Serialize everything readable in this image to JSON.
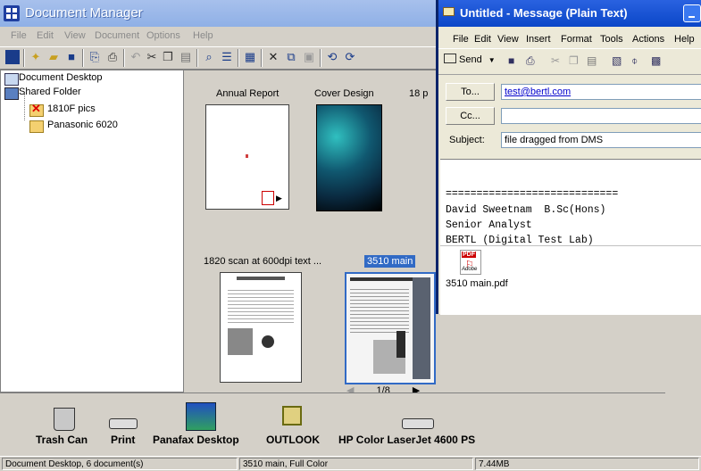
{
  "main_window": {
    "title": "Document Manager",
    "menu": [
      "File",
      "Edit",
      "View",
      "Document",
      "Options",
      "Help"
    ]
  },
  "tree": {
    "items": [
      {
        "label": "Document Desktop",
        "icon": "document-desktop-icon"
      },
      {
        "label": "Shared Folder",
        "icon": "shared-folder-icon"
      },
      {
        "label": "1810F pics",
        "icon": "folder-x-icon"
      },
      {
        "label": "Panasonic 6020",
        "icon": "folder-icon"
      }
    ]
  },
  "documents": [
    {
      "label": "Annual Report"
    },
    {
      "label": "Cover Design"
    },
    {
      "label": "18 p"
    },
    {
      "label": "1820 scan at 600dpi text ..."
    },
    {
      "label": "3510 main",
      "selected": true
    }
  ],
  "pager": {
    "text": "1/8"
  },
  "dock": {
    "items": [
      "Trash Can",
      "Print",
      "Panafax Desktop",
      "OUTLOOK",
      "HP Color LaserJet 4600 PS"
    ]
  },
  "status": {
    "left": "Document Desktop, 6 document(s)",
    "middle": "3510 main, Full Color",
    "right": "7.44MB"
  },
  "message": {
    "title": "Untitled - Message (Plain Text)",
    "menu": [
      "File",
      "Edit",
      "View",
      "Insert",
      "Format",
      "Tools",
      "Actions",
      "Help"
    ],
    "send_label": "Send",
    "to_button": "To...",
    "to_value": "test@bertl.com",
    "cc_button": "Cc...",
    "cc_value": "",
    "subject_label": "Subject:",
    "subject_value": "file dragged from DMS",
    "body_lines": [
      "============================",
      "David Sweetnam  B.Sc(Hons)",
      "Senior Analyst",
      "BERTL (Digital Test Lab)"
    ],
    "attachment": {
      "name": "3510 main.pdf",
      "badge": "PDF",
      "brand": "Adobe"
    }
  },
  "colors": {
    "selection": "#316ac5",
    "xp_title": "#0a46c8"
  }
}
